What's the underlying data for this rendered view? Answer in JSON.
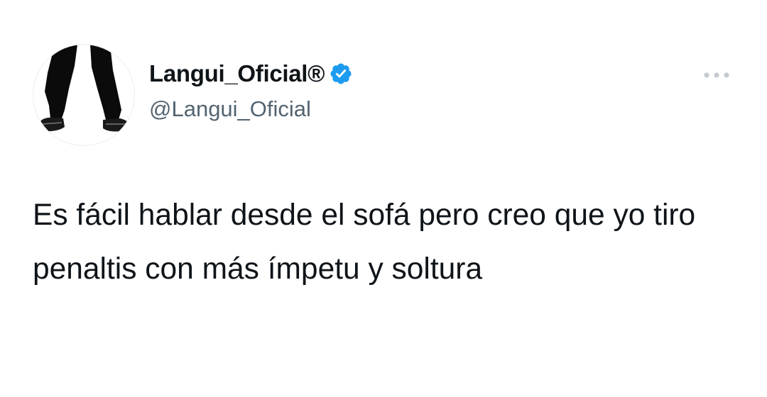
{
  "author": {
    "display_name": "Langui_Oficial®",
    "handle": "@Langui_Oficial",
    "verified": true,
    "avatar_icon": "legs-and-shoes-icon"
  },
  "tweet": {
    "text": "Es fácil hablar desde el sofá pero creo que yo tiro penaltis con más ímpetu y soltura"
  },
  "icons": {
    "verified": "verified-badge-icon",
    "more": "more-options-icon"
  },
  "colors": {
    "text_primary": "#0f1419",
    "text_secondary": "#536471",
    "verified_blue": "#1d9bf0"
  }
}
